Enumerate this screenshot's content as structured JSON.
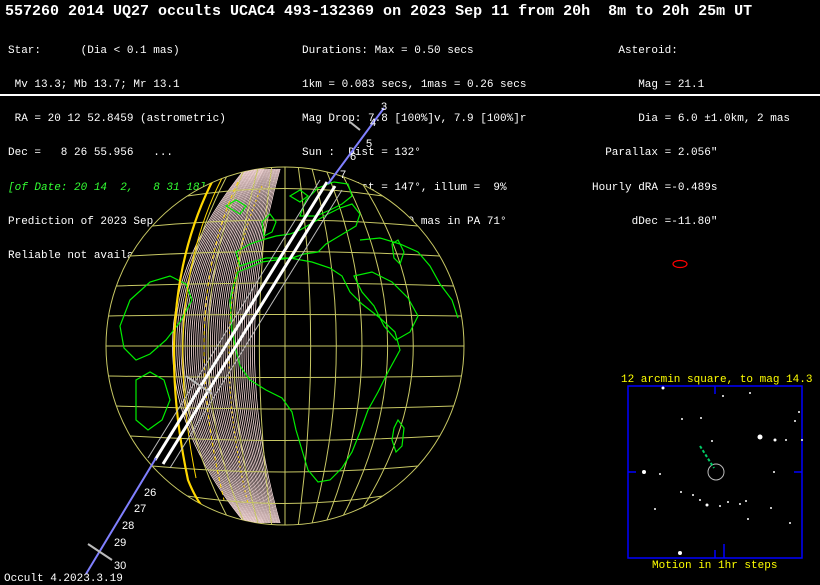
{
  "title": "557260 2014 UQ27 occults UCAC4 493-132369 on 2023 Sep 11 from 20h  8m to 20h 25m UT",
  "star": {
    "lines": [
      "Star:      (Dia < 0.1 mas)",
      " Mv 13.3; Mb 13.7; Mr 13.1",
      " RA = 20 12 52.8459 (astrometric)",
      "Dec =   8 26 55.956   ...",
      "[of Date: 20 14  2,   8 31 18]",
      "Prediction of 2023 Sep  6.0",
      "Reliable not available"
    ]
  },
  "event": {
    "lines": [
      "Durations: Max = 0.50 secs",
      "1km = 0.083 secs, 1mas = 0.26 secs",
      "Mag Drop: 7.8 [100%]v, 7.9 [100%]r",
      "Sun :  Dist = 132°",
      "Moon:  Dist = 147°, illum =  9%",
      "Error 80.0 x 43.0 mas in PA 71°"
    ]
  },
  "asteroid": {
    "lines": [
      "    Asteroid:",
      "       Mag = 21.1",
      "       Dia = 6.0 ±1.0km, 2 mas",
      "  Parallax = 2.056\"",
      "Hourly dRA =-0.489s",
      "      dDec =-11.80\""
    ]
  },
  "path_ticks_upper": [
    "3",
    "4",
    "5",
    "6",
    "7"
  ],
  "path_ticks_lower": [
    "26",
    "27",
    "28",
    "29",
    "30"
  ],
  "starchart": {
    "title": "12 arcmin square, to mag 14.3",
    "motion_label": "Motion in 1hr steps"
  },
  "footer": "Occult 4.2023.3.19",
  "colors": {
    "text": "#ffffff",
    "highlight": "#33ff33",
    "grid": "#c8c864",
    "coast": "#00ee00",
    "path": "#ffffff",
    "limit": "#ffd700",
    "box": "#0000ff",
    "label": "#ffff00",
    "marker": "#ff0000"
  }
}
